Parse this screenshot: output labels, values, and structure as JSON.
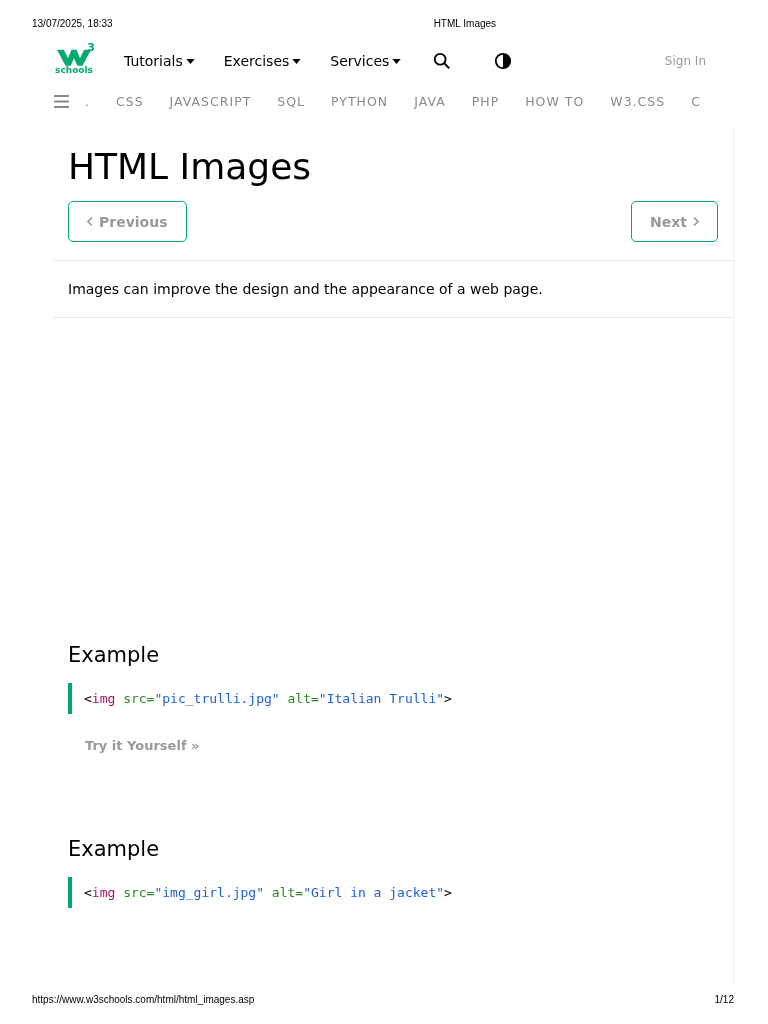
{
  "print_header": {
    "date": "13/07/2025, 18:33",
    "title": "HTML Images"
  },
  "nav": {
    "menus": [
      "Tutorials",
      "Exercises",
      "Services"
    ],
    "sign_in": "Sign In",
    "logo_text": "schools",
    "logo_sup": "3"
  },
  "topics": [
    ".",
    "CSS",
    "JAVASCRIPT",
    "SQL",
    "PYTHON",
    "JAVA",
    "PHP",
    "HOW TO",
    "W3.CSS",
    "C"
  ],
  "page": {
    "title": "HTML Images",
    "previous": "Previous",
    "next": "Next",
    "intro": "Images can improve the design and the appearance of a web page."
  },
  "examples": [
    {
      "heading": "Example",
      "code": [
        {
          "kind": "bracket",
          "text": "<"
        },
        {
          "kind": "tag",
          "text": "img"
        },
        {
          "kind": "attr",
          "text": " src="
        },
        {
          "kind": "value",
          "text": "\"pic_trulli.jpg\""
        },
        {
          "kind": "attr",
          "text": " alt="
        },
        {
          "kind": "value",
          "text": "\"Italian Trulli\""
        },
        {
          "kind": "bracket",
          "text": ">"
        }
      ],
      "try_link": "Try it Yourself »"
    },
    {
      "heading": "Example",
      "code": [
        {
          "kind": "bracket",
          "text": "<"
        },
        {
          "kind": "tag",
          "text": "img"
        },
        {
          "kind": "attr",
          "text": " src="
        },
        {
          "kind": "value",
          "text": "\"img_girl.jpg\""
        },
        {
          "kind": "attr",
          "text": " alt="
        },
        {
          "kind": "value",
          "text": "\"Girl in a jacket\""
        },
        {
          "kind": "bracket",
          "text": ">"
        }
      ]
    }
  ],
  "print_footer": {
    "url": "https://www.w3schools.com/html/html_images.asp",
    "page": "1/12"
  }
}
